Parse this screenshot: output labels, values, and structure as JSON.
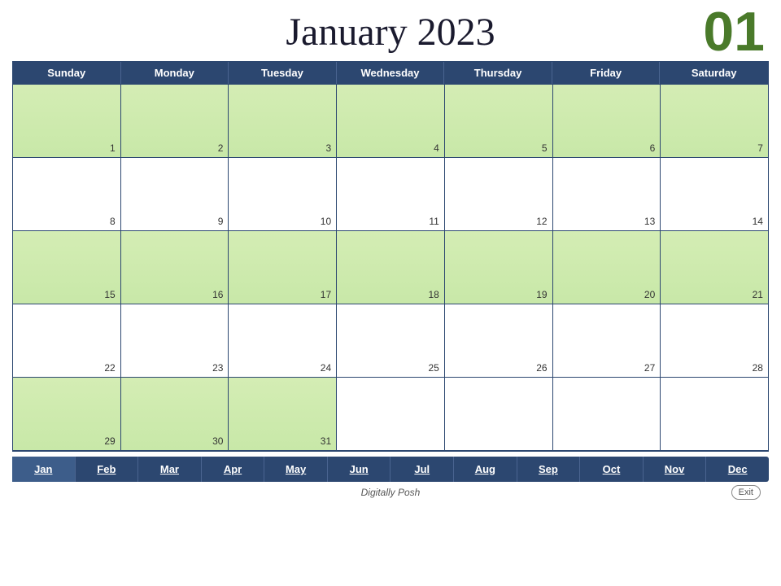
{
  "header": {
    "month_year": "January 2023",
    "month_number": "01"
  },
  "day_headers": [
    "Sunday",
    "Monday",
    "Tuesday",
    "Wednesday",
    "Thursday",
    "Friday",
    "Saturday"
  ],
  "weeks": [
    {
      "style": "green",
      "days": [
        {
          "number": "1",
          "empty": false
        },
        {
          "number": "2",
          "empty": false
        },
        {
          "number": "3",
          "empty": false
        },
        {
          "number": "4",
          "empty": false
        },
        {
          "number": "5",
          "empty": false
        },
        {
          "number": "6",
          "empty": false
        },
        {
          "number": "7",
          "empty": false
        }
      ]
    },
    {
      "style": "white",
      "days": [
        {
          "number": "8",
          "empty": false
        },
        {
          "number": "9",
          "empty": false
        },
        {
          "number": "10",
          "empty": false
        },
        {
          "number": "11",
          "empty": false
        },
        {
          "number": "12",
          "empty": false
        },
        {
          "number": "13",
          "empty": false
        },
        {
          "number": "14",
          "empty": false
        }
      ]
    },
    {
      "style": "green",
      "days": [
        {
          "number": "15",
          "empty": false
        },
        {
          "number": "16",
          "empty": false
        },
        {
          "number": "17",
          "empty": false
        },
        {
          "number": "18",
          "empty": false
        },
        {
          "number": "19",
          "empty": false
        },
        {
          "number": "20",
          "empty": false
        },
        {
          "number": "21",
          "empty": false
        }
      ]
    },
    {
      "style": "white",
      "days": [
        {
          "number": "22",
          "empty": false
        },
        {
          "number": "23",
          "empty": false
        },
        {
          "number": "24",
          "empty": false
        },
        {
          "number": "25",
          "empty": false
        },
        {
          "number": "26",
          "empty": false
        },
        {
          "number": "27",
          "empty": false
        },
        {
          "number": "28",
          "empty": false
        }
      ]
    },
    {
      "style": "green",
      "days": [
        {
          "number": "29",
          "empty": false
        },
        {
          "number": "30",
          "empty": false
        },
        {
          "number": "31",
          "empty": false
        },
        {
          "number": "",
          "empty": true
        },
        {
          "number": "",
          "empty": true
        },
        {
          "number": "",
          "empty": true
        },
        {
          "number": "",
          "empty": true
        }
      ]
    }
  ],
  "month_nav": [
    {
      "label": "Jan",
      "active": true
    },
    {
      "label": "Feb",
      "active": false
    },
    {
      "label": "Mar",
      "active": false
    },
    {
      "label": "Apr",
      "active": false
    },
    {
      "label": "May",
      "active": false
    },
    {
      "label": "Jun",
      "active": false
    },
    {
      "label": "Jul",
      "active": false
    },
    {
      "label": "Aug",
      "active": false
    },
    {
      "label": "Sep",
      "active": false
    },
    {
      "label": "Oct",
      "active": false
    },
    {
      "label": "Nov",
      "active": false
    },
    {
      "label": "Dec",
      "active": false
    }
  ],
  "footer": {
    "brand": "Digitally Posh",
    "exit_label": "Exit"
  }
}
